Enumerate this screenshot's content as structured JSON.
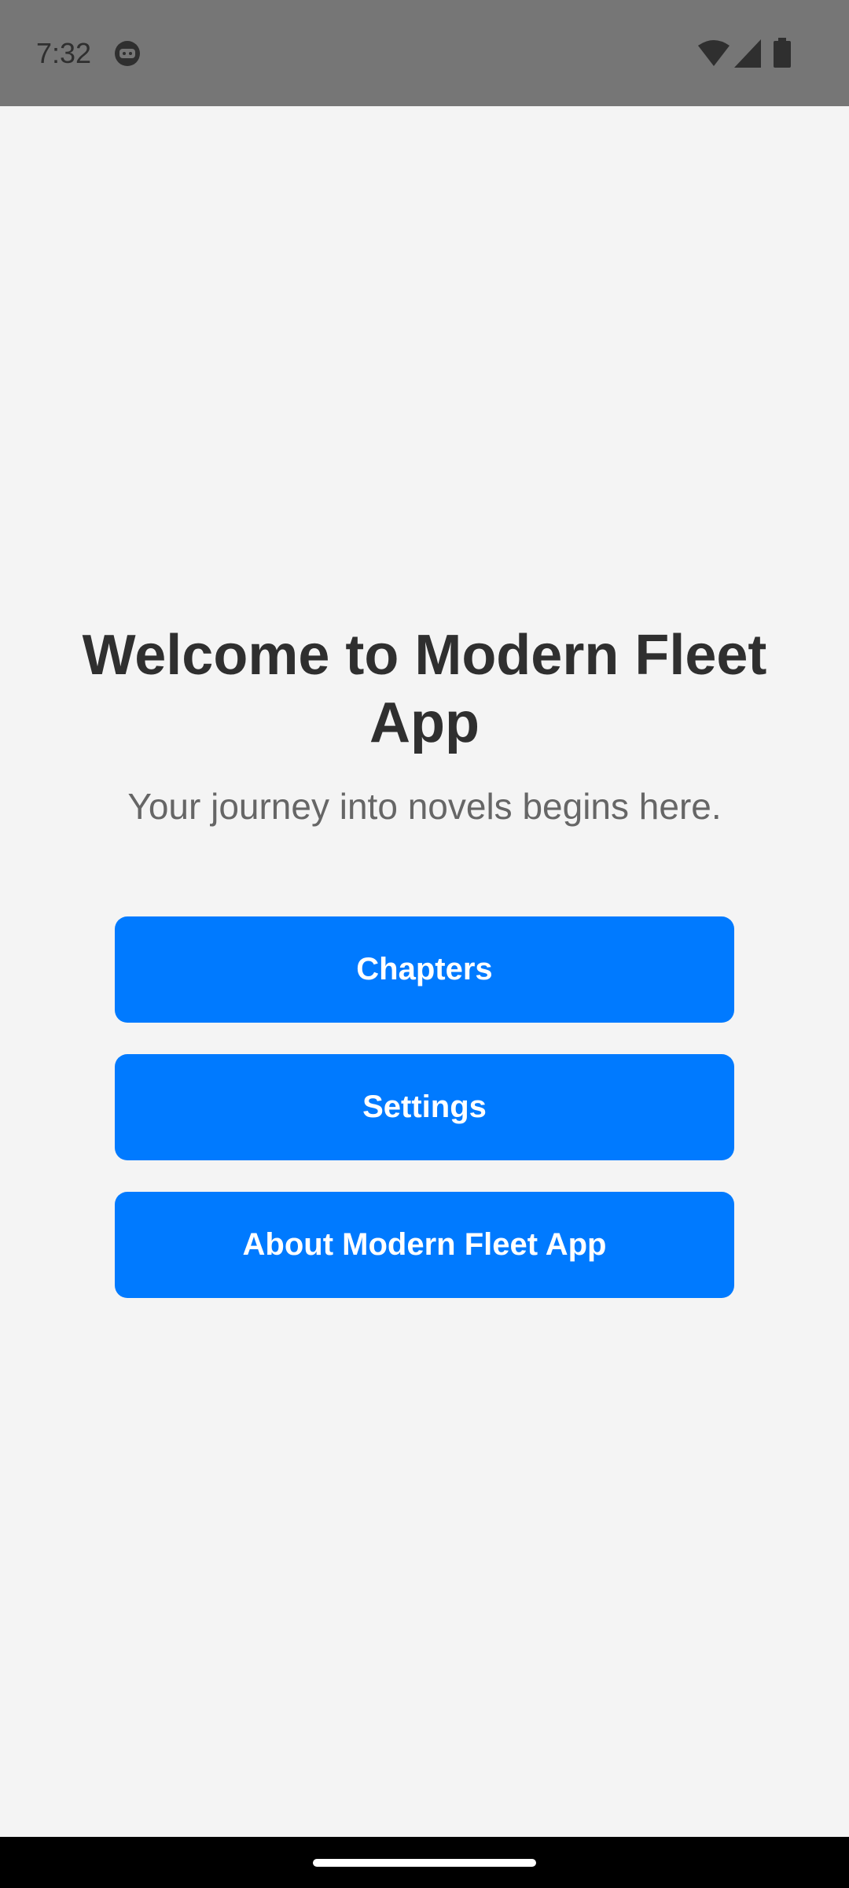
{
  "status_bar": {
    "time": "7:32",
    "app_icon": "android-robot-icon",
    "wifi_icon": "wifi-icon",
    "signal_icon": "cell-signal-icon",
    "battery_icon": "battery-icon"
  },
  "main": {
    "title": "Welcome to Modern Fleet App",
    "subtitle": "Your journey into novels begins here.",
    "buttons": [
      {
        "label": "Chapters"
      },
      {
        "label": "Settings"
      },
      {
        "label": "About Modern Fleet App"
      }
    ]
  },
  "colors": {
    "background": "#f4f4f4",
    "status_bar": "#767676",
    "button": "#007aff",
    "button_text": "#ffffff",
    "title": "#2f2f2f",
    "subtitle": "#666666",
    "nav_bar": "#000000"
  }
}
